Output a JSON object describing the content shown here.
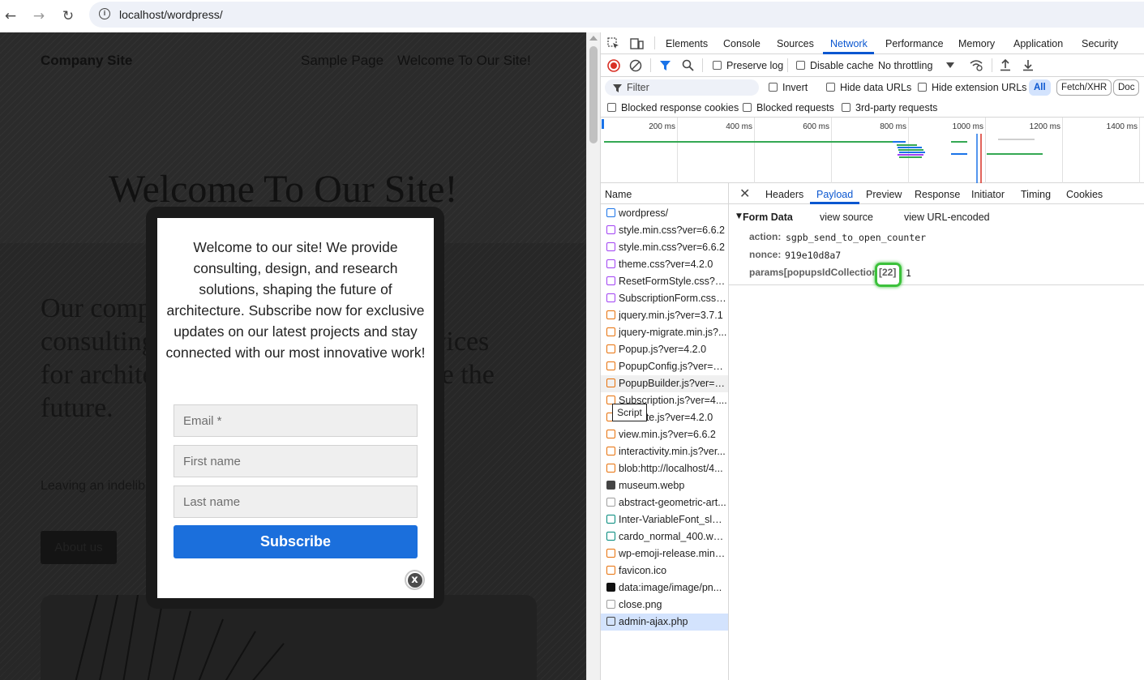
{
  "browser": {
    "url": "localhost/wordpress/",
    "back_glyph": "←",
    "forward_glyph": "→",
    "reload_glyph": "↻",
    "info_glyph": "i"
  },
  "site": {
    "brand": "Company Site",
    "nav": [
      "Sample Page",
      "Welcome To Our Site!"
    ],
    "hero_title": "Welcome To Our Site!",
    "lead_text": "Our company provides innovative consulting, design, and research services for architectural endeavors that shape the future.",
    "small_text": "Leaving an indelible mark on the landscape of tomorrow.",
    "about_button": "About us"
  },
  "popup": {
    "message": "Welcome to our site! We provide consulting, design, and research solutions, shaping the future of architecture. Subscribe now for exclusive updates on our latest projects and stay connected with our most innovative work!",
    "email_placeholder": "Email *",
    "first_name_placeholder": "First name",
    "last_name_placeholder": "Last name",
    "subscribe_label": "Subscribe",
    "close_glyph": "x"
  },
  "devtools": {
    "tabs": [
      "Elements",
      "Console",
      "Sources",
      "Network",
      "Performance",
      "Memory",
      "Application",
      "Security"
    ],
    "active_tab": "Network",
    "toolbar": {
      "preserve_log": "Preserve log",
      "disable_cache": "Disable cache",
      "throttling": "No throttling"
    },
    "filter": {
      "placeholder": "Filter",
      "invert": "Invert",
      "hide_data_urls": "Hide data URLs",
      "hide_extension_urls": "Hide extension URLs",
      "type_all": "All",
      "type_fetch": "Fetch/XHR",
      "type_doc": "Doc"
    },
    "blocking": {
      "blocked_cookies": "Blocked response cookies",
      "blocked_requests": "Blocked requests",
      "third_party": "3rd-party requests"
    },
    "timeline_ticks": [
      "200 ms",
      "400 ms",
      "600 ms",
      "800 ms",
      "1000 ms",
      "1200 ms",
      "1400 ms"
    ],
    "requests_header": "Name",
    "requests": [
      {
        "name": "wordpress/",
        "type": "doc",
        "color": "#1a73e8"
      },
      {
        "name": "style.min.css?ver=6.6.2",
        "type": "css",
        "color": "#a142f4"
      },
      {
        "name": "style.min.css?ver=6.6.2",
        "type": "css",
        "color": "#a142f4"
      },
      {
        "name": "theme.css?ver=4.2.0",
        "type": "css",
        "color": "#a142f4"
      },
      {
        "name": "ResetFormStyle.css?ver...",
        "type": "css",
        "color": "#a142f4"
      },
      {
        "name": "SubscriptionForm.css?...",
        "type": "css",
        "color": "#a142f4"
      },
      {
        "name": "jquery.min.js?ver=3.7.1",
        "type": "js",
        "color": "#e8710a"
      },
      {
        "name": "jquery-migrate.min.js?...",
        "type": "js",
        "color": "#e8710a"
      },
      {
        "name": "Popup.js?ver=4.2.0",
        "type": "js",
        "color": "#e8710a"
      },
      {
        "name": "PopupConfig.js?ver=4....",
        "type": "js",
        "color": "#e8710a"
      },
      {
        "name": "PopupBuilder.js?ver=4....",
        "type": "js",
        "color": "#e8710a"
      },
      {
        "name": "Subscription.js?ver=4....",
        "type": "js",
        "color": "#e8710a"
      },
      {
        "name": "Validate.js?ver=4.2.0",
        "type": "js",
        "color": "#e8710a"
      },
      {
        "name": "view.min.js?ver=6.6.2",
        "type": "js",
        "color": "#e8710a"
      },
      {
        "name": "interactivity.min.js?ver...",
        "type": "js",
        "color": "#e8710a"
      },
      {
        "name": "blob:http://localhost/4...",
        "type": "js",
        "color": "#e8710a"
      },
      {
        "name": "museum.webp",
        "type": "img",
        "color": "#444444"
      },
      {
        "name": "abstract-geometric-art...",
        "type": "img",
        "color": "#9e9e9e"
      },
      {
        "name": "Inter-VariableFont_slnt...",
        "type": "font",
        "color": "#00897b"
      },
      {
        "name": "cardo_normal_400.woff2",
        "type": "font",
        "color": "#00897b"
      },
      {
        "name": "wp-emoji-release.min.j...",
        "type": "js",
        "color": "#e8710a"
      },
      {
        "name": "favicon.ico",
        "type": "img",
        "color": "#e8710a"
      },
      {
        "name": "data:image/image/pn...",
        "type": "img",
        "color": "#111111"
      },
      {
        "name": "close.png",
        "type": "img",
        "color": "#9e9e9e"
      },
      {
        "name": "admin-ajax.php",
        "type": "fetch",
        "color": "#474747"
      }
    ],
    "tooltip": "Script",
    "detail_tabs": [
      "Headers",
      "Payload",
      "Preview",
      "Response",
      "Initiator",
      "Timing",
      "Cookies"
    ],
    "detail_active": "Payload",
    "form_data": {
      "title": "Form Data",
      "view_source": "view source",
      "view_url_encoded": "view URL-encoded",
      "fields": [
        {
          "key": "action:",
          "value": "sgpb_send_to_open_counter"
        },
        {
          "key": "nonce:",
          "value": "919e10d8a7"
        },
        {
          "key": "params[popupsIdCollection]",
          "index": "[22]",
          "value": "1"
        }
      ]
    },
    "colors": {
      "accent": "#0b57d0",
      "highlight": "#3cc13b",
      "subscribe": "#1b6fdc"
    }
  }
}
